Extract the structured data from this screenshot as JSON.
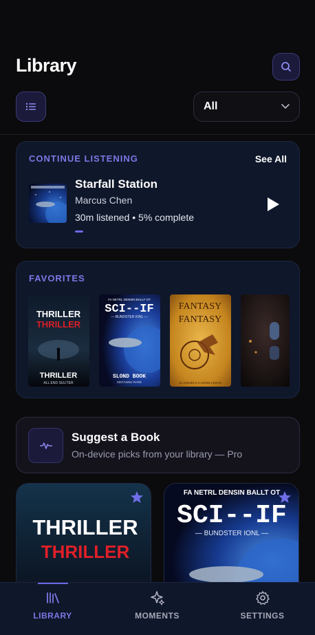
{
  "header": {
    "title": "Library",
    "filter": {
      "selected": "All"
    }
  },
  "continue_listening": {
    "label": "CONTINUE LISTENING",
    "see_all": "See All",
    "book": {
      "title": "Starfall Station",
      "author": "Marcus Chen",
      "progress_text": "30m listened • 5% complete",
      "progress": 0.05
    }
  },
  "favorites": {
    "label": "FAVORITES",
    "books": [
      {
        "line1": "THRILLER",
        "line2": "THRILLER",
        "bottom1": "THRILLER",
        "bottom2": "ALL END SULITER"
      },
      {
        "top": "FA NETRL DENSIN BALLT OT",
        "line1": "SCI--IF",
        "sub": "— BUNDSTER IONL —",
        "bottom1": "SLOND BOOK",
        "bottom2": "SINTANND RARE"
      },
      {
        "line1": "FANTASY",
        "line2": "FANTASY",
        "bottom1": "ACADEMICS A ADORLLEDON"
      },
      {
        "line1": ""
      }
    ]
  },
  "suggest": {
    "title": "Suggest a Book",
    "subtitle": "On-device picks from your library — Pro"
  },
  "grid": [
    {
      "line1": "THRILLER",
      "line2": "THRILLER"
    },
    {
      "top": "FA NETRL DENSIN BALLT OT",
      "line1": "SCI--IF",
      "sub": "— BUNDSTER IONL —"
    }
  ],
  "nav": {
    "items": [
      {
        "label": "LIBRARY",
        "icon": "library-icon",
        "active": true
      },
      {
        "label": "MOMENTS",
        "icon": "sparkle-icon",
        "active": false
      },
      {
        "label": "SETTINGS",
        "icon": "gear-icon",
        "active": false
      }
    ]
  },
  "colors": {
    "accent": "#7b78e6",
    "card": "#0f172a",
    "background": "#0b0b0d"
  }
}
